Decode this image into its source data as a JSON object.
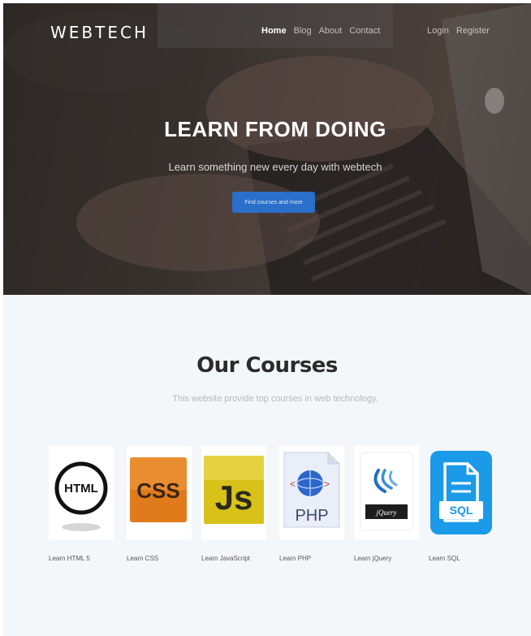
{
  "header": {
    "brand": "WEBTECH",
    "nav": [
      {
        "label": "Home",
        "active": true
      },
      {
        "label": "Blog",
        "active": false
      },
      {
        "label": "About",
        "active": false
      },
      {
        "label": "Contact",
        "active": false
      }
    ],
    "auth": [
      "Login",
      "Register"
    ]
  },
  "hero": {
    "title": "LEARN FROM DOING",
    "subtitle": "Learn something new every day with webtech",
    "button_label": "Find courses and more"
  },
  "courses": {
    "title": "Our Courses",
    "subtitle": "This website provide top courses in web technology.",
    "items": [
      {
        "label": "Learn HTML 5",
        "logo_text": "HTML",
        "icon": "html5-logo-icon"
      },
      {
        "label": "Learn CSS",
        "logo_text": "CSS",
        "icon": "css-logo-icon"
      },
      {
        "label": "Learn JavaScript",
        "logo_text": "Js",
        "icon": "javascript-logo-icon"
      },
      {
        "label": "Learn PHP",
        "logo_text": "PHP",
        "icon": "php-logo-icon"
      },
      {
        "label": "Learn jQuery",
        "logo_text": "jQuery",
        "icon": "jquery-logo-icon"
      },
      {
        "label": "Learn SQL",
        "logo_text": "SQL",
        "icon": "sql-logo-icon"
      }
    ]
  },
  "colors": {
    "button": "#2a6fc9",
    "section_background": "#f4f7fa",
    "css_orange": "#e07b1c",
    "js_yellow": "#d8c21a",
    "sql_blue": "#1a9ae8"
  }
}
